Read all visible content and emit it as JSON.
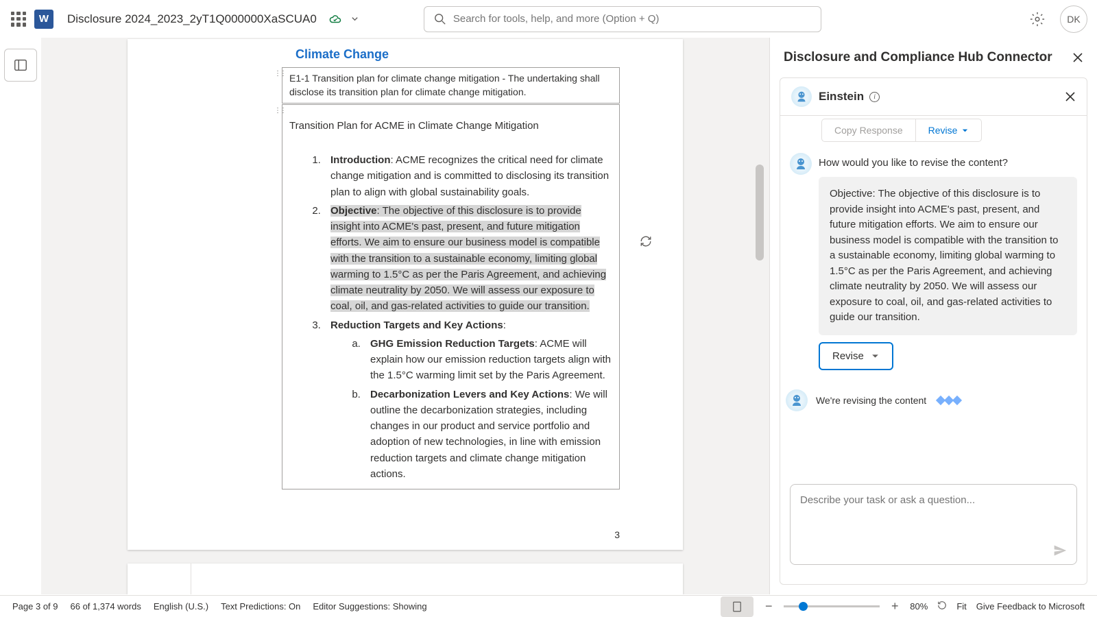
{
  "header": {
    "doc_title": "Disclosure 2024_2023_2yT1Q000000XaSCUA0",
    "search_placeholder": "Search for tools, help, and more (Option + Q)",
    "avatar_initials": "DK",
    "word_letter": "W"
  },
  "document": {
    "heading": "Climate Change",
    "section_header": "E1-1 Transition plan for climate change mitigation - The undertaking shall disclose its transition plan for climate change mitigation.",
    "plan_title": "Transition Plan for ACME in Climate Change Mitigation",
    "items": {
      "intro_label": "Introduction",
      "intro_text": ": ACME recognizes the critical need for climate change mitigation and is committed to disclosing its transition plan to align with global sustainability goals.",
      "objective_label": "Objective",
      "objective_text": ": The objective of this disclosure is to provide insight into ACME's past, present, and future mitigation efforts. We aim to ensure our business model is compatible with the transition to a sustainable economy, limiting global warming to 1.5°C as per the Paris Agreement, and achieving climate neutrality by 2050. We will assess our exposure to coal, oil, and gas-related activities to guide our transition.",
      "reduction_label": "Reduction Targets and Key Actions",
      "reduction_colon": ":",
      "ghg_label": "GHG Emission Reduction Targets",
      "ghg_text": ": ACME will explain how our emission reduction targets align with the 1.5°C warming limit set by the Paris Agreement.",
      "decarb_label": "Decarbonization Levers and Key Actions",
      "decarb_text": ": We will outline the decarbonization strategies, including changes in our product and service portfolio and adoption of new technologies, in line with emission reduction targets and climate change mitigation actions."
    },
    "page_number": "3"
  },
  "panel": {
    "title": "Disclosure and Compliance Hub Connector",
    "assistant_name": "Einstein",
    "copy_response": "Copy Response",
    "revise_top": "Revise",
    "question": "How would you like to revise the content?",
    "context": "Objective: The objective of this disclosure is to provide insight into ACME's past, present, and future mitigation efforts. We aim to ensure our business model is compatible with the transition to a sustainable economy, limiting global warming to 1.5°C as per the Paris Agreement, and achieving climate neutrality by 2050. We will assess our exposure to coal, oil, and gas-related activities to guide our transition.",
    "revise_btn": "Revise",
    "revising_text": "We're revising the content",
    "input_placeholder": "Describe your task or ask a question..."
  },
  "statusbar": {
    "page": "Page 3 of 9",
    "words": "66 of 1,374 words",
    "language": "English (U.S.)",
    "predictions": "Text Predictions: On",
    "editor": "Editor Suggestions: Showing",
    "zoom": "80%",
    "fit": "Fit",
    "feedback": "Give Feedback to Microsoft"
  }
}
